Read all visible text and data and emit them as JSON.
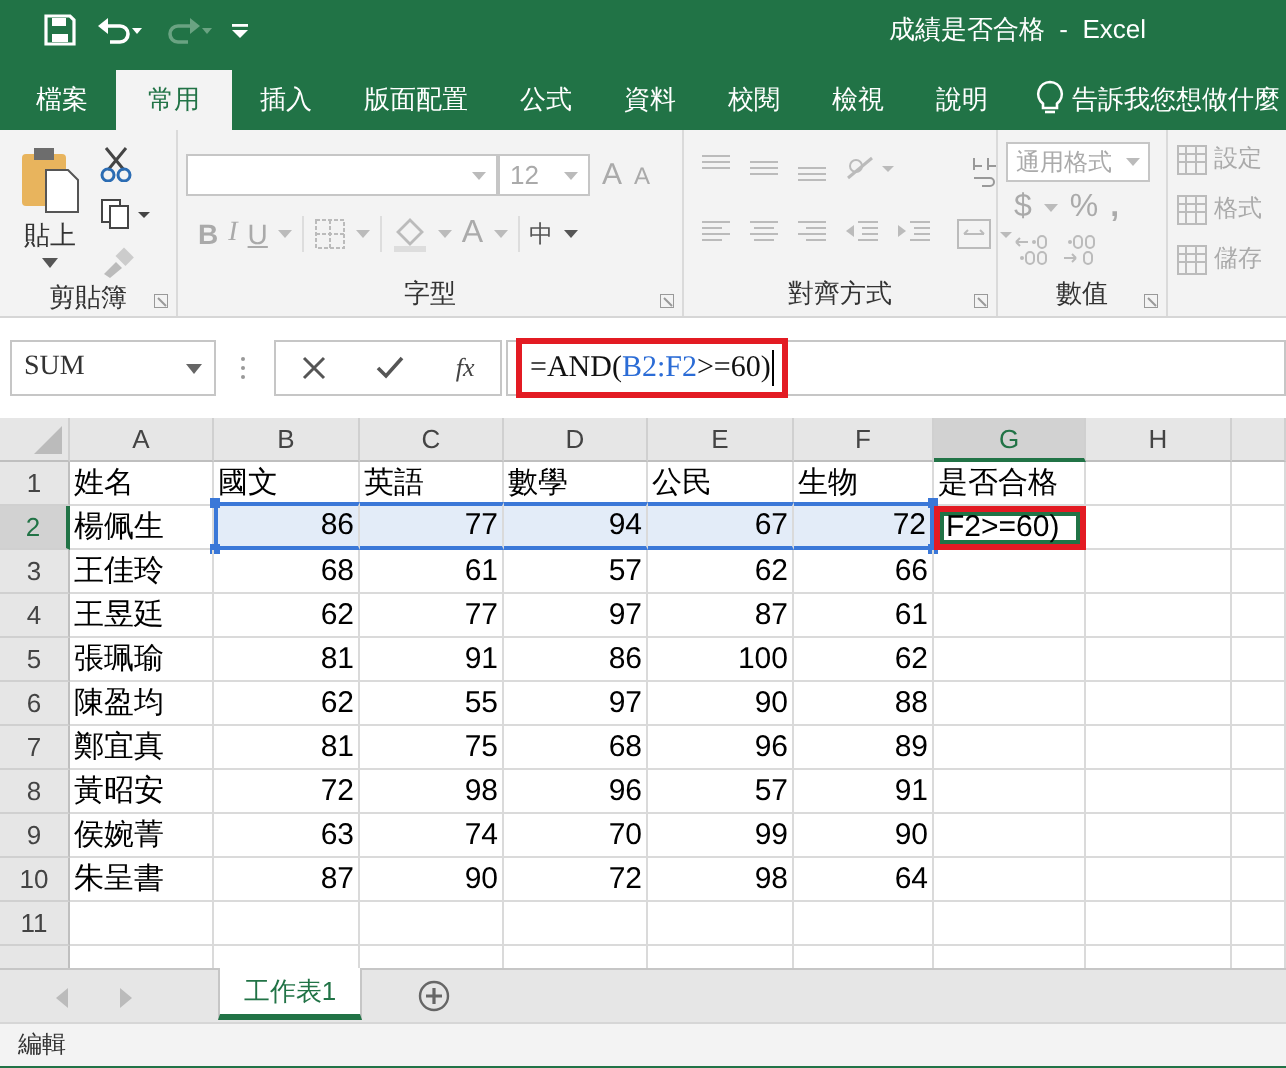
{
  "window": {
    "title": "成績是否合格  -  Excel"
  },
  "ribbon_tabs": [
    {
      "label": "檔案",
      "selected": false
    },
    {
      "label": "常用",
      "selected": true
    },
    {
      "label": "插入",
      "selected": false
    },
    {
      "label": "版面配置",
      "selected": false
    },
    {
      "label": "公式",
      "selected": false
    },
    {
      "label": "資料",
      "selected": false
    },
    {
      "label": "校閱",
      "selected": false
    },
    {
      "label": "檢視",
      "selected": false
    },
    {
      "label": "說明",
      "selected": false
    }
  ],
  "tell_me": "告訴我您想做什麼",
  "clipboard": {
    "label": "剪貼簿",
    "paste": "貼上"
  },
  "font": {
    "label": "字型",
    "size": "12",
    "grow": "A",
    "shrink": "A",
    "bold": "B",
    "italic": "I",
    "underline": "U",
    "font_color": "A",
    "convert": "中"
  },
  "alignment": {
    "label": "對齊方式"
  },
  "number": {
    "label": "數值",
    "format": "通用格式",
    "currency": "$",
    "percent": "%",
    "comma": ","
  },
  "styles": [
    {
      "label": "設定"
    },
    {
      "label": "格式"
    },
    {
      "label": "儲存"
    }
  ],
  "formula_bar": {
    "name_box": "SUM",
    "function_button": "fx",
    "highlighted": true,
    "formula": [
      {
        "text": "=AND(",
        "reference": false
      },
      {
        "text": "B2:F2",
        "reference": true
      },
      {
        "text": ">=60)",
        "reference": false
      }
    ]
  },
  "sheet": {
    "active_cell_highlighted": true,
    "columns": [
      {
        "label": "A",
        "selected": false,
        "referenced": false,
        "numeric": false
      },
      {
        "label": "B",
        "selected": false,
        "referenced": true,
        "numeric": true
      },
      {
        "label": "C",
        "selected": false,
        "referenced": true,
        "numeric": true
      },
      {
        "label": "D",
        "selected": false,
        "referenced": true,
        "numeric": true
      },
      {
        "label": "E",
        "selected": false,
        "referenced": true,
        "numeric": true
      },
      {
        "label": "F",
        "selected": false,
        "referenced": true,
        "numeric": true
      },
      {
        "label": "G",
        "selected": true,
        "referenced": false,
        "numeric": false
      },
      {
        "label": "H",
        "selected": false
      }
    ],
    "rows": [
      {
        "number": "1",
        "selected": false,
        "kind": "header",
        "cells": [
          "姓名",
          "國文",
          "英語",
          "數學",
          "公民",
          "生物",
          "是否合格"
        ]
      },
      {
        "number": "2",
        "selected": true,
        "kind": "data",
        "cells": [
          "楊佩生",
          "86",
          "77",
          "94",
          "67",
          "72",
          "F2>=60)"
        ]
      },
      {
        "number": "3",
        "selected": false,
        "kind": "data",
        "cells": [
          "王佳玲",
          "68",
          "61",
          "57",
          "62",
          "66"
        ]
      },
      {
        "number": "4",
        "selected": false,
        "kind": "data",
        "cells": [
          "王昱廷",
          "62",
          "77",
          "97",
          "87",
          "61"
        ]
      },
      {
        "number": "5",
        "selected": false,
        "kind": "data",
        "cells": [
          "張珮瑜",
          "81",
          "91",
          "86",
          "100",
          "62"
        ]
      },
      {
        "number": "6",
        "selected": false,
        "kind": "data",
        "cells": [
          "陳盈均",
          "62",
          "55",
          "97",
          "90",
          "88"
        ]
      },
      {
        "number": "7",
        "selected": false,
        "kind": "data",
        "cells": [
          "鄭宜真",
          "81",
          "75",
          "68",
          "96",
          "89"
        ]
      },
      {
        "number": "8",
        "selected": false,
        "kind": "data",
        "cells": [
          "黃昭安",
          "72",
          "98",
          "96",
          "57",
          "91"
        ]
      },
      {
        "number": "9",
        "selected": false,
        "kind": "data",
        "cells": [
          "侯婉菁",
          "63",
          "74",
          "70",
          "99",
          "90"
        ]
      },
      {
        "number": "10",
        "selected": false,
        "kind": "data",
        "cells": [
          "朱呈書",
          "87",
          "90",
          "72",
          "98",
          "64"
        ]
      },
      {
        "number": "11",
        "selected": false,
        "kind": "data"
      }
    ]
  },
  "sheet_tabs": [
    {
      "label": "工作表1",
      "selected": true
    }
  ],
  "status_bar": {
    "mode": "編輯"
  }
}
